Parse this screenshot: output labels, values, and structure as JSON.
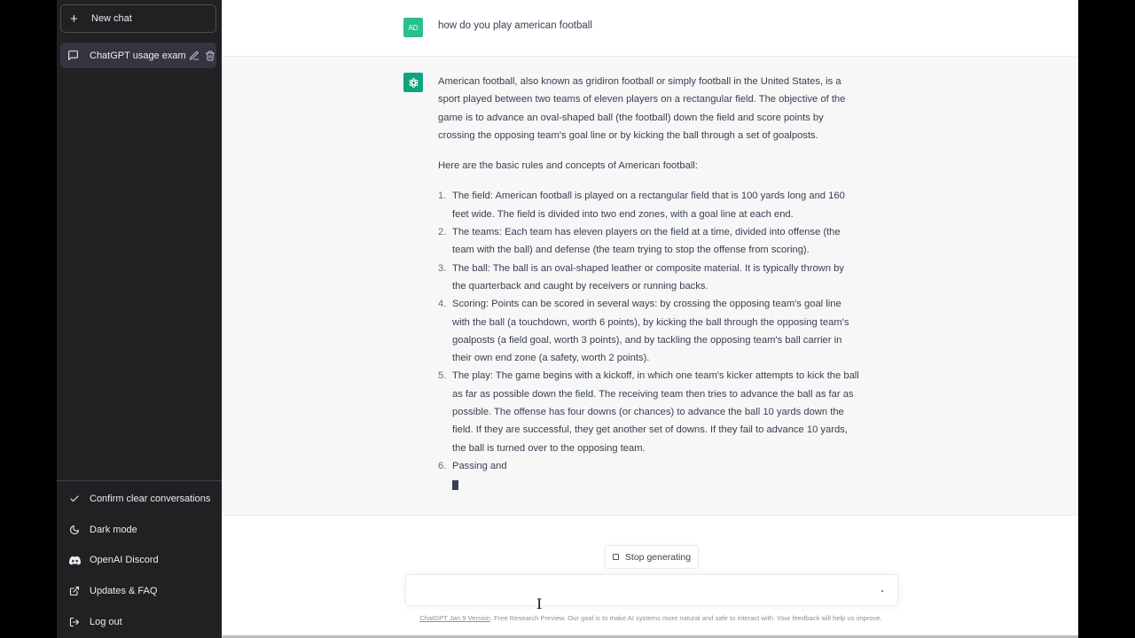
{
  "sidebar": {
    "new_chat_label": "New chat",
    "conversations": [
      {
        "title": "ChatGPT usage exampl",
        "icons": [
          "message-icon",
          "edit-icon",
          "trash-icon"
        ]
      }
    ],
    "menu": [
      {
        "label": "Confirm clear conversations",
        "icon": "check-icon"
      },
      {
        "label": "Dark mode",
        "icon": "moon-icon"
      },
      {
        "label": "OpenAI Discord",
        "icon": "discord-icon"
      },
      {
        "label": "Updates & FAQ",
        "icon": "external-link-icon"
      },
      {
        "label": "Log out",
        "icon": "logout-icon"
      }
    ]
  },
  "thread": {
    "user": {
      "avatar_initials": "AD",
      "avatar_color": "#2bbf8e",
      "message": "how do you play american football"
    },
    "assistant": {
      "avatar_color": "#10a37f",
      "paragraphs": [
        "American football, also known as gridiron football or simply football in the United States, is a sport played between two teams of eleven players on a rectangular field. The objective of the game is to advance an oval-shaped ball (the football) down the field and score points by crossing the opposing team's goal line or by kicking the ball through a set of goalposts.",
        "Here are the basic rules and concepts of American football:"
      ],
      "list": [
        {
          "num": "1.",
          "text": "The field: American football is played on a rectangular field that is 100 yards long and 160 feet wide. The field is divided into two end zones, with a goal line at each end."
        },
        {
          "num": "2.",
          "text": "The teams: Each team has eleven players on the field at a time, divided into offense (the team with the ball) and defense (the team trying to stop the offense from scoring)."
        },
        {
          "num": "3.",
          "text": "The ball: The ball is an oval-shaped leather or composite material. It is typically thrown by the quarterback and caught by receivers or running backs."
        },
        {
          "num": "4.",
          "text": "Scoring: Points can be scored in several ways: by crossing the opposing team's goal line with the ball (a touchdown, worth 6 points), by kicking the ball through the opposing team's goalposts (a field goal, worth 3 points), and by tackling the opposing team's ball carrier in their own end zone (a safety, worth 2 points)."
        },
        {
          "num": "5.",
          "text": "The play: The game begins with a kickoff, in which one team's kicker attempts to kick the ball as far as possible down the field. The receiving team then tries to advance the ball as far as possible. The offense has four downs (or chances) to advance the ball 10 yards down the field. If they are successful, they get another set of downs. If they fail to advance 10 yards, the ball is turned over to the opposing team."
        },
        {
          "num": "6.",
          "text": "Passing and"
        }
      ]
    }
  },
  "composer": {
    "stop_label": "Stop generating",
    "input_value": "",
    "input_placeholder": ""
  },
  "footer": {
    "version_link": "ChatGPT Jan 9 Version",
    "text": ". Free Research Preview. Our goal is to make AI systems more natural and safe to interact with. Your feedback will help us improve."
  }
}
